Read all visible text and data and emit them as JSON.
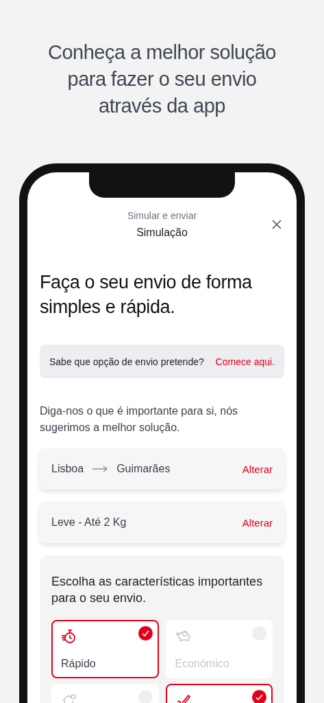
{
  "headline": [
    "Conheça a melhor solução",
    "para fazer o seu envio",
    "através da app"
  ],
  "screen": {
    "subtitle": "Simular e enviar",
    "title": "Simulação",
    "heading": "Faça o seu envio de forma simples e rápida.",
    "info": {
      "text": "Sabe que opção de envio pretende?",
      "link": "Comece aqui."
    },
    "intro": "Diga-nos o que é importante para si, nós sugerimos a melhor solução.",
    "route": {
      "from": "Lisboa",
      "to": "Guimarães",
      "action": "Alterar"
    },
    "weight": {
      "text": "Leve - Até 2 Kg",
      "action": "Alterar"
    },
    "panel": {
      "title": "Escolha as características importantes para o seu envio.",
      "options": [
        {
          "label": "Rápido",
          "selected": true
        },
        {
          "label": "Económico",
          "selected": false
        },
        {
          "selected": false
        },
        {
          "selected": true
        }
      ]
    }
  }
}
